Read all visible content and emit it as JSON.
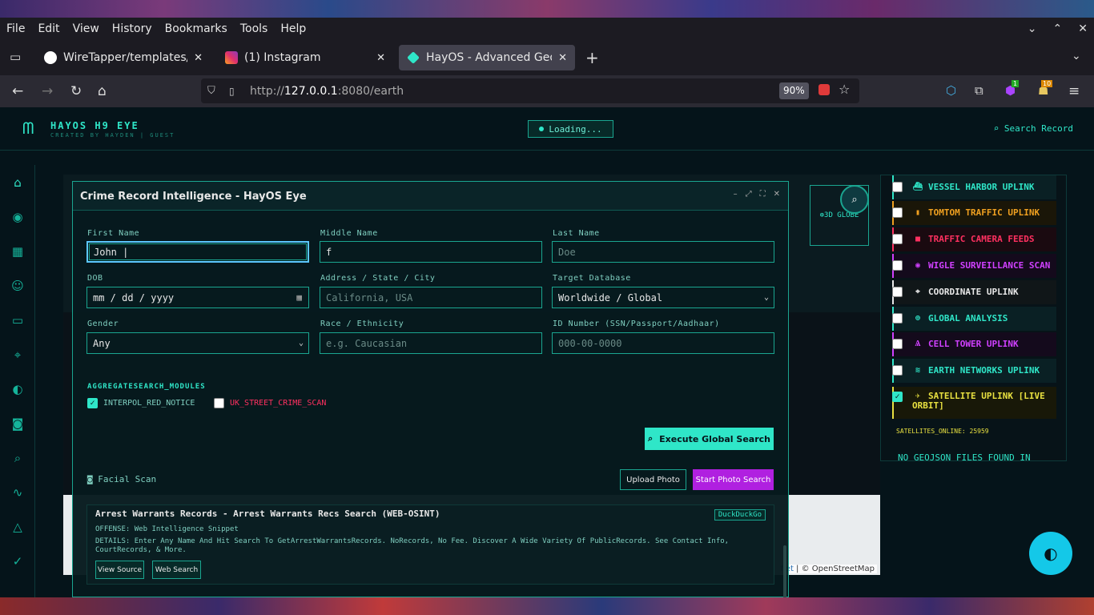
{
  "browser": {
    "menu": [
      "File",
      "Edit",
      "View",
      "History",
      "Bookmarks",
      "Tools",
      "Help"
    ],
    "tabs": [
      {
        "title": "WireTapper/templates/wifi",
        "color": "#ffffff"
      },
      {
        "title": "(1) Instagram",
        "color": "#e1306c"
      },
      {
        "title": "HayOS - Advanced Geo Tra",
        "color": "#2fe6c8"
      }
    ],
    "url": {
      "prefix": "http://",
      "host": "127.0.0.1",
      "rest": ":8080/earth"
    },
    "zoom": "90%",
    "badges": {
      "ext1": "1",
      "ext2": "10"
    }
  },
  "app": {
    "logo_title": "HAYOS H9 EYE",
    "logo_sub": "CREATED BY HAYDEN | GUEST",
    "loading": "Loading...",
    "search_record": "Search Record",
    "globe_btn": "3D GLOBE",
    "map_attr_link": "flet",
    "map_attr": "© OpenStreetMap",
    "colors": {
      "accent": "#2fe6c8",
      "magenta": "#b020e0",
      "bg": "#05141a"
    }
  },
  "layers": [
    {
      "label": "VESSEL HARBOR UPLINK",
      "color": "#2fe6c8",
      "checked": false,
      "icon": "ship-icon"
    },
    {
      "label": "TOMTOM TRAFFIC UPLINK",
      "color": "#f0a020",
      "checked": false,
      "icon": "traffic-icon"
    },
    {
      "label": "TRAFFIC CAMERA FEEDS",
      "color": "#ff3060",
      "checked": false,
      "icon": "camera-icon"
    },
    {
      "label": "WIGLE SURVEILLANCE SCAN",
      "color": "#d040ff",
      "checked": false,
      "icon": "eye-icon"
    },
    {
      "label": "COORDINATE UPLINK",
      "color": "#e8e8e8",
      "checked": false,
      "icon": "pin-icon"
    },
    {
      "label": "GLOBAL ANALYSIS",
      "color": "#2fe6c8",
      "checked": false,
      "icon": "globe-icon"
    },
    {
      "label": "CELL TOWER UPLINK",
      "color": "#d040ff",
      "checked": false,
      "icon": "tower-icon"
    },
    {
      "label": "EARTH NETWORKS UPLINK",
      "color": "#2fe6c8",
      "checked": false,
      "icon": "wifi-icon"
    },
    {
      "label": "SATELLITE UPLINK [LIVE",
      "label2": "ORBIT]",
      "color": "#e8e040",
      "checked": true,
      "icon": "satellite-icon"
    }
  ],
  "sat_count": "SATELLITES_ONLINE: 25959",
  "no_geojson": "NO GEOJSON FILES FOUND IN",
  "dialog": {
    "title": "Crime Record Intelligence - HayOS Eye",
    "fields": {
      "first_name": {
        "label": "First Name",
        "value": "John |"
      },
      "middle_name": {
        "label": "Middle Name",
        "value": "f"
      },
      "last_name": {
        "label": "Last Name",
        "placeholder": "Doe"
      },
      "dob": {
        "label": "DOB",
        "value": "mm / dd / yyyy"
      },
      "address": {
        "label": "Address / State / City",
        "placeholder": "California, USA"
      },
      "target_db": {
        "label": "Target Database",
        "value": "Worldwide / Global"
      },
      "gender": {
        "label": "Gender",
        "value": "Any"
      },
      "race": {
        "label": "Race / Ethnicity",
        "placeholder": "e.g. Caucasian"
      },
      "id_number": {
        "label": "ID Number (SSN/Passport/Aadhaar)",
        "placeholder": "000-00-0000"
      }
    },
    "modules_title": "AGGREGATESEARCH_MODULES",
    "module1": {
      "label": "INTERPOL_RED_NOTICE",
      "checked": true
    },
    "module2": {
      "label": "UK_STREET_CRIME_SCAN",
      "checked": false
    },
    "execute_btn": "Execute Global Search",
    "facial": "Facial Scan",
    "upload_btn": "Upload Photo",
    "start_btn": "Start Photo Search",
    "result": {
      "title": "Arrest Warrants Records - Arrest Warrants Recs Search (WEB-OSINT)",
      "badge": "DuckDuckGo",
      "offense": "OFFENSE: Web Intelligence Snippet",
      "details": "DETAILS: Enter Any Name And Hit Search To GetArrestWarrantsRecords. NoRecords, No Fee. Discover A Wide Variety Of PublicRecords. See Contact Info, CourtRecords, & More.",
      "view_btn": "View Source",
      "web_btn": "Web Search"
    }
  }
}
